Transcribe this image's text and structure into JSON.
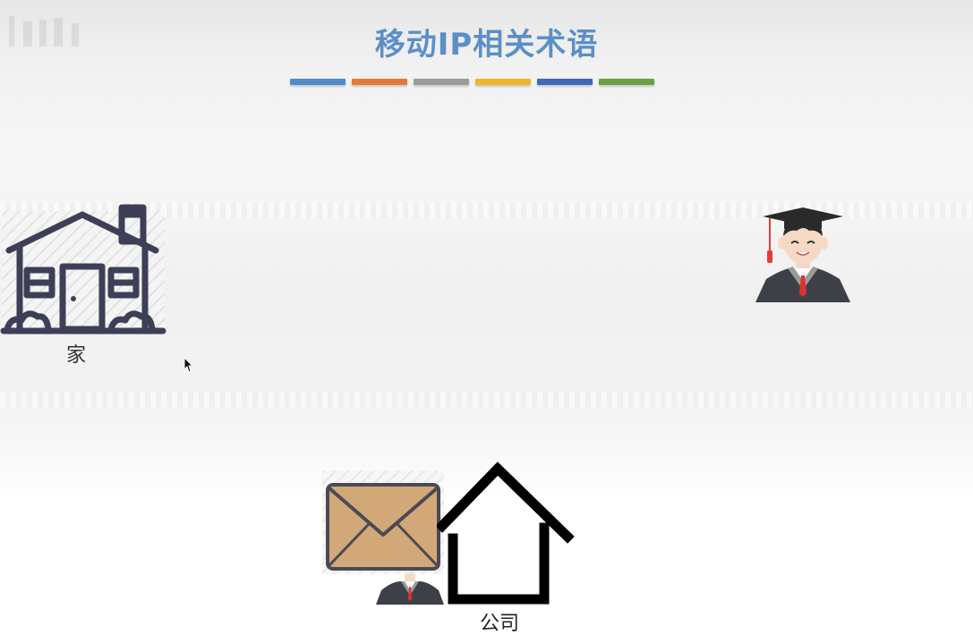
{
  "slide": {
    "title": "移动IP相关术语",
    "title_color": "#5b8fc6",
    "color_bar": [
      "#4f8cc9",
      "#e07a3a",
      "#9a9a9a",
      "#f0b52d",
      "#3f68b5",
      "#6aa145"
    ]
  },
  "icons": {
    "home": "house-outline-icon",
    "graduate": "graduate-student-icon",
    "envelope": "envelope-icon",
    "company": "house-outline-icon",
    "cursor": "mouse-pointer-icon"
  },
  "labels": {
    "home": "家",
    "company": "公司"
  },
  "colors": {
    "home_stroke": "#3d3f57",
    "envelope_fill": "#d2a878",
    "envelope_stroke": "#4a4a55",
    "gown": "#3e4048",
    "cap": "#2a2a2a",
    "tassel": "#e23b3b",
    "skin": "#f5d9c4"
  }
}
